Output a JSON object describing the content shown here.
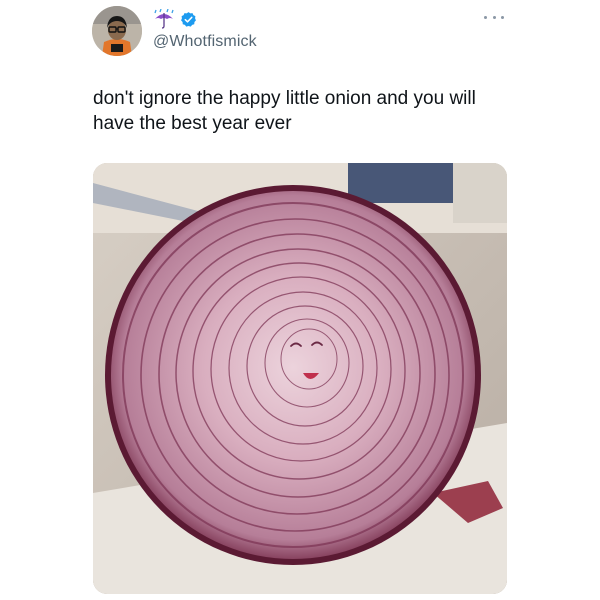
{
  "tweet": {
    "handle": "@Whotfismick",
    "name_emoji": "umbrella-with-rain-icon",
    "verified_icon": "verified-badge-icon",
    "text": "don't ignore the happy little onion and you will\nhave the best year ever",
    "more_icon": "more-options-icon",
    "media_description_icon": "onion-photo",
    "colors": {
      "verified": "#1d9bf0",
      "handle": "#536471",
      "text": "#0f1419"
    }
  }
}
